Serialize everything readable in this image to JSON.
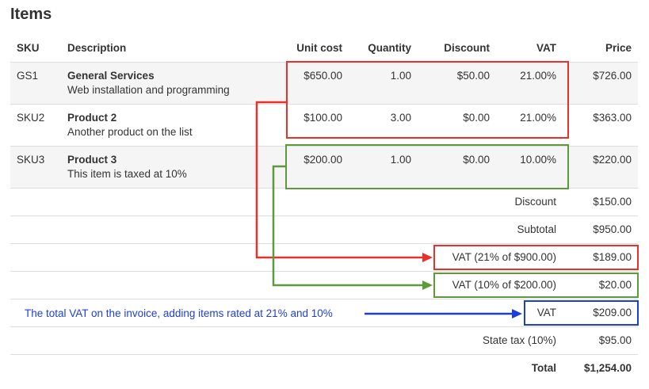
{
  "title": "Items",
  "columns": {
    "sku": "SKU",
    "description": "Description",
    "unit_cost": "Unit cost",
    "quantity": "Quantity",
    "discount": "Discount",
    "vat": "VAT",
    "price": "Price"
  },
  "items": [
    {
      "sku": "GS1",
      "name": "General Services",
      "desc": "Web installation and programming",
      "unit_cost": "$650.00",
      "quantity": "1.00",
      "discount": "$50.00",
      "vat": "21.00%",
      "price": "$726.00"
    },
    {
      "sku": "SKU2",
      "name": "Product 2",
      "desc": "Another product on the list",
      "unit_cost": "$100.00",
      "quantity": "3.00",
      "discount": "$0.00",
      "vat": "21.00%",
      "price": "$363.00"
    },
    {
      "sku": "SKU3",
      "name": "Product 3",
      "desc": "This item is taxed at 10%",
      "unit_cost": "$200.00",
      "quantity": "1.00",
      "discount": "$0.00",
      "vat": "10.00%",
      "price": "$220.00"
    }
  ],
  "summary": [
    {
      "label": "Discount",
      "value": "$150.00"
    },
    {
      "label": "Subtotal",
      "value": "$950.00"
    },
    {
      "label": "VAT (21% of $900.00)",
      "value": "$189.00"
    },
    {
      "label": "VAT (10% of $200.00)",
      "value": "$20.00"
    },
    {
      "label": "VAT",
      "value": "$209.00"
    },
    {
      "label": "State tax (10%)",
      "value": "$95.00"
    },
    {
      "label": "Total",
      "value": "$1,254.00"
    }
  ],
  "annotation": "The total VAT on the invoice, adding items rated at 21% and 10%",
  "colors": {
    "red": "#e8312a",
    "green": "#5c9a3b",
    "blue": "#1f3fd4",
    "stripe": "#f5f5f5",
    "divider": "#dddddd"
  }
}
